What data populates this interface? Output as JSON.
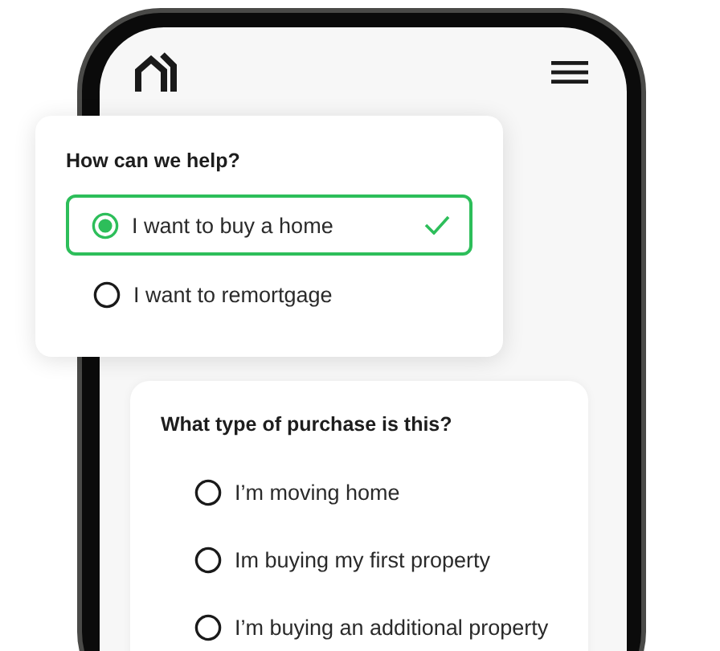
{
  "help_card": {
    "title": "How can we help?",
    "options": [
      {
        "label": "I want to buy a home",
        "selected": true
      },
      {
        "label": "I want to remortgage",
        "selected": false
      }
    ]
  },
  "purchase_card": {
    "title": "What type of purchase is this?",
    "options": [
      {
        "label": "I’m moving home",
        "selected": false
      },
      {
        "label": "Im buying my first property",
        "selected": false
      },
      {
        "label": "I’m buying an additional property",
        "selected": false
      }
    ]
  }
}
